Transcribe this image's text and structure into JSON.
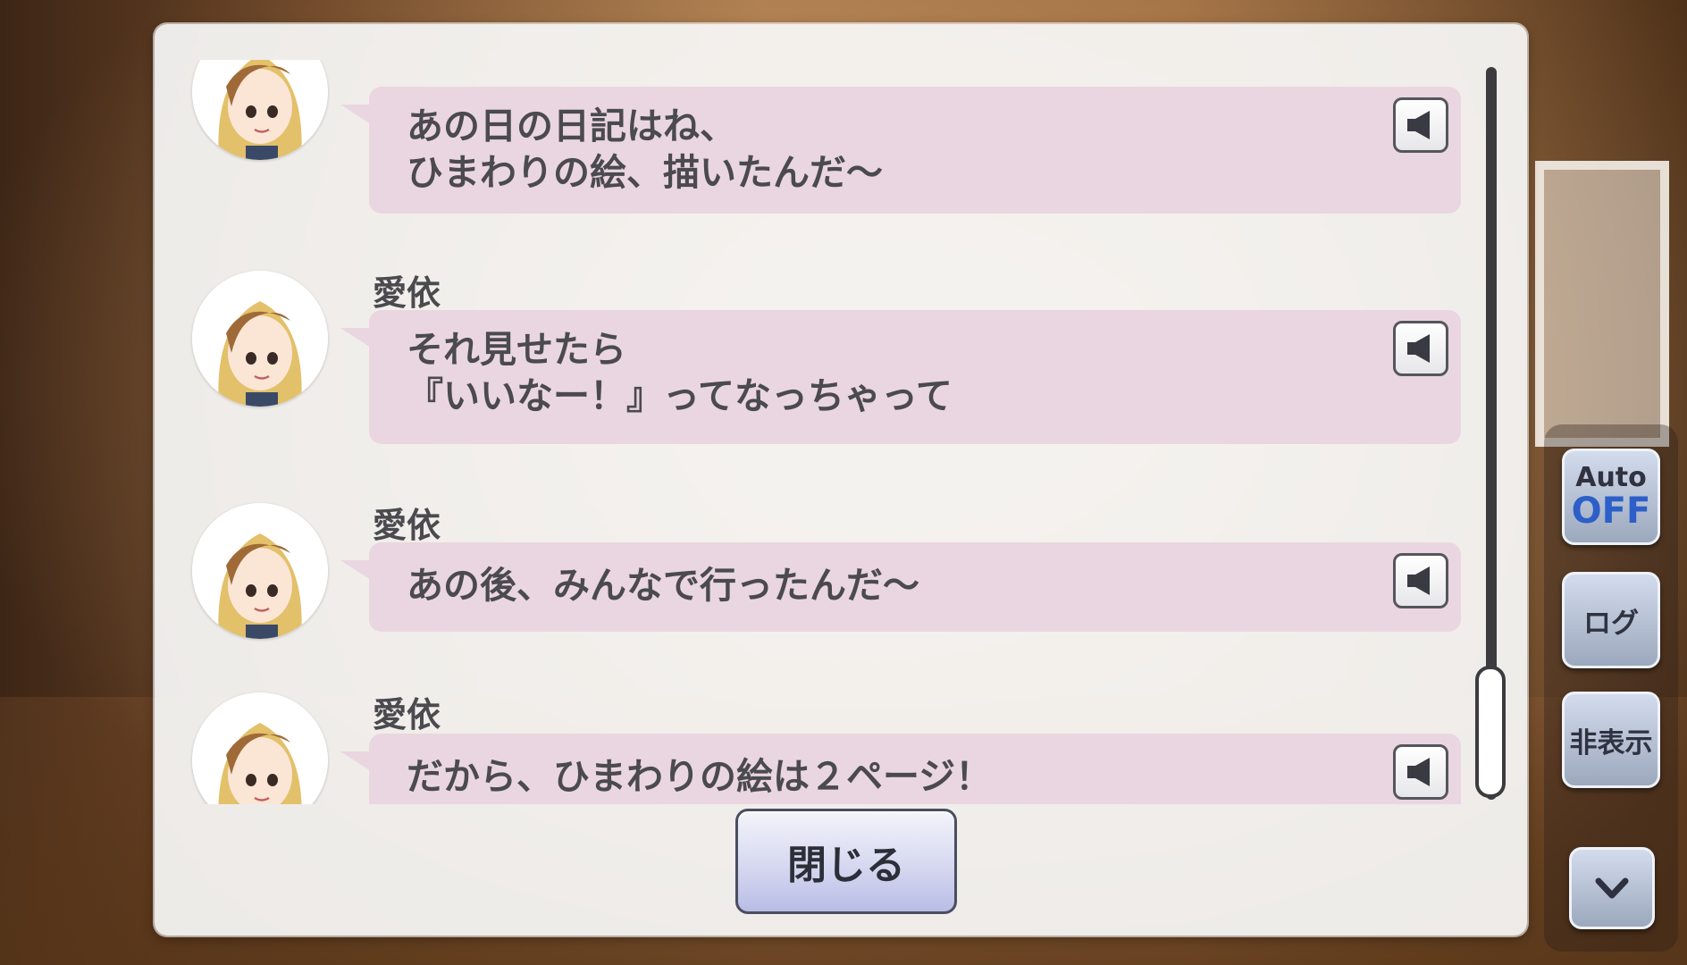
{
  "log": {
    "entries": [
      {
        "speaker": "",
        "lines": [
          "あの日の日記はね、",
          "ひまわりの絵、描いたんだ～"
        ]
      },
      {
        "speaker": "愛依",
        "lines": [
          "それ見せたら",
          "『いいなー！』ってなっちゃって"
        ]
      },
      {
        "speaker": "愛依",
        "lines": [
          "あの後、みんなで行ったんだ～"
        ]
      },
      {
        "speaker": "愛依",
        "lines": [
          "だから、ひまわりの絵は２ページ！"
        ]
      }
    ],
    "close_label": "閉じる"
  },
  "side_menu": {
    "auto_label": "Auto",
    "auto_state": "OFF",
    "log_label": "ログ",
    "hide_label": "非表示"
  },
  "colors": {
    "bubble": "#ead6e0",
    "auto_state": "#2d5fc8"
  }
}
